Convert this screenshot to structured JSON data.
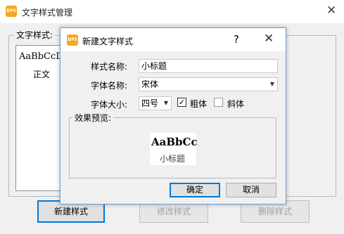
{
  "app": {
    "icon_text": "DPS",
    "icon_color": "#f5a623"
  },
  "background_window": {
    "title": "文字样式管理",
    "close_glyph": "✕",
    "group_label": "文字样式:",
    "list_items": [
      {
        "sample": "AaBbCcDd",
        "name": "正文"
      }
    ],
    "buttons": {
      "new": "新建样式",
      "modify": "修改样式",
      "delete": "删除样式"
    }
  },
  "dialog": {
    "title": "新建文字样式",
    "help_glyph": "?",
    "close_glyph": "✕",
    "style_name": {
      "label": "样式名称:",
      "value": "小标题"
    },
    "font_name": {
      "label": "字体名称:",
      "value": "宋体"
    },
    "font_size": {
      "label": "字体大小:",
      "value": "四号"
    },
    "bold": {
      "label": "粗体",
      "checked": true
    },
    "italic": {
      "label": "斜体",
      "checked": false
    },
    "preview": {
      "label": "效果预览:",
      "sample": "AaBbCc",
      "name": "小标题"
    },
    "ok_label": "确定",
    "cancel_label": "取消",
    "accent_color": "#0078d7"
  }
}
